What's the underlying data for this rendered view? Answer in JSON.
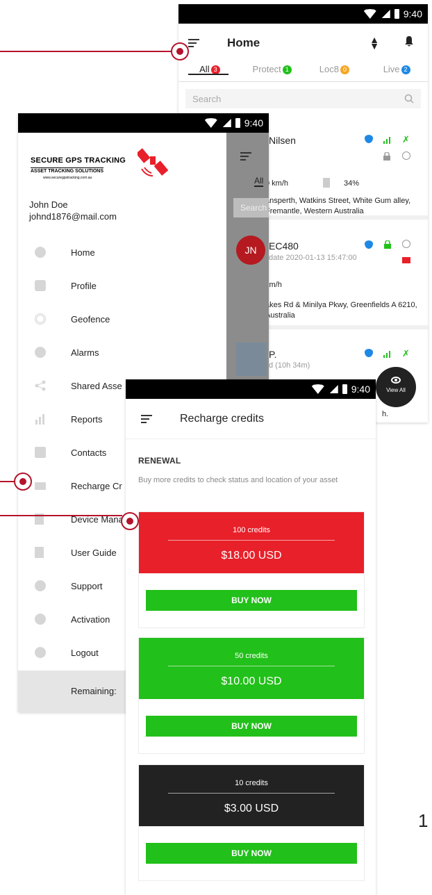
{
  "status_bar": {
    "time": "9:40"
  },
  "home_screen": {
    "title": "Home",
    "tabs": [
      {
        "label": "All",
        "count": "3",
        "color": "#e8202a",
        "active": true
      },
      {
        "label": "Protect",
        "count": "1",
        "color": "#22c01a",
        "active": false
      },
      {
        "label": "Loc8",
        "count": "0",
        "color": "#f5a623",
        "active": false
      },
      {
        "label": "Live",
        "count": "2",
        "color": "#1e88e5",
        "active": false
      }
    ],
    "search_placeholder": "Search",
    "assets": [
      {
        "name": "Nilsen",
        "date": "",
        "speed": "0 km/h",
        "battery": "34%",
        "address": "ansperth, Watkins Street, White Gum alley, Fremantle, Western Australia"
      },
      {
        "name": "EC480",
        "date": "date 2020-01-13 15:47:00",
        "speed": "km/h",
        "battery": "",
        "address": "akes Rd & Minilya Pkwy, Greenfields A 6210, Australia"
      },
      {
        "name": "P.",
        "date": "d (10h 34m)",
        "speed": "",
        "battery": "",
        "address": ""
      }
    ],
    "avatar_initials": "JN",
    "view_all_label": "View All",
    "background_fragment": "h."
  },
  "drawer_screen": {
    "logo_line1": "SECURE GPS TRACKING",
    "logo_line2": "ASSET TRACKING SOLUTIONS",
    "logo_line3": "www.securegpstracking.com.au",
    "user_name": "John Doe",
    "user_email": "johnd1876@mail.com",
    "menu": [
      {
        "label": "Home",
        "icon": "home-icon"
      },
      {
        "label": "Profile",
        "icon": "gear-icon"
      },
      {
        "label": "Geofence",
        "icon": "geofence-icon"
      },
      {
        "label": "Alarms",
        "icon": "alarm-icon"
      },
      {
        "label": "Shared Asse",
        "icon": "share-icon"
      },
      {
        "label": "Reports",
        "icon": "bar-chart-icon"
      },
      {
        "label": "Contacts",
        "icon": "contacts-icon"
      },
      {
        "label": "Recharge Cr",
        "icon": "credit-card-icon"
      },
      {
        "label": "Device Mana",
        "icon": "device-icon"
      },
      {
        "label": "User Guide",
        "icon": "document-icon"
      },
      {
        "label": "Support",
        "icon": "info-icon"
      },
      {
        "label": "Activation",
        "icon": "activation-icon"
      },
      {
        "label": "Logout",
        "icon": "power-icon"
      }
    ],
    "remaining_label": "Remaining:",
    "bg_tab_label": "All",
    "bg_search_label": "Search"
  },
  "recharge_screen": {
    "title": "Recharge credits",
    "section_heading": "RENEWAL",
    "section_description": "Buy more credits to check status and location of your asset",
    "packages": [
      {
        "credits": "100 credits",
        "price": "$18.00 USD",
        "color": "#e8202a",
        "button": "BUY NOW"
      },
      {
        "credits": "50 credits",
        "price": "$10.00 USD",
        "color": "#22c01a",
        "button": "BUY NOW"
      },
      {
        "credits": "10 credits",
        "price": "$3.00 USD",
        "color": "#222222",
        "button": "BUY NOW"
      }
    ]
  },
  "colors": {
    "callout": "#b5122b",
    "buy_button": "#22c01a"
  },
  "page_number": "1"
}
